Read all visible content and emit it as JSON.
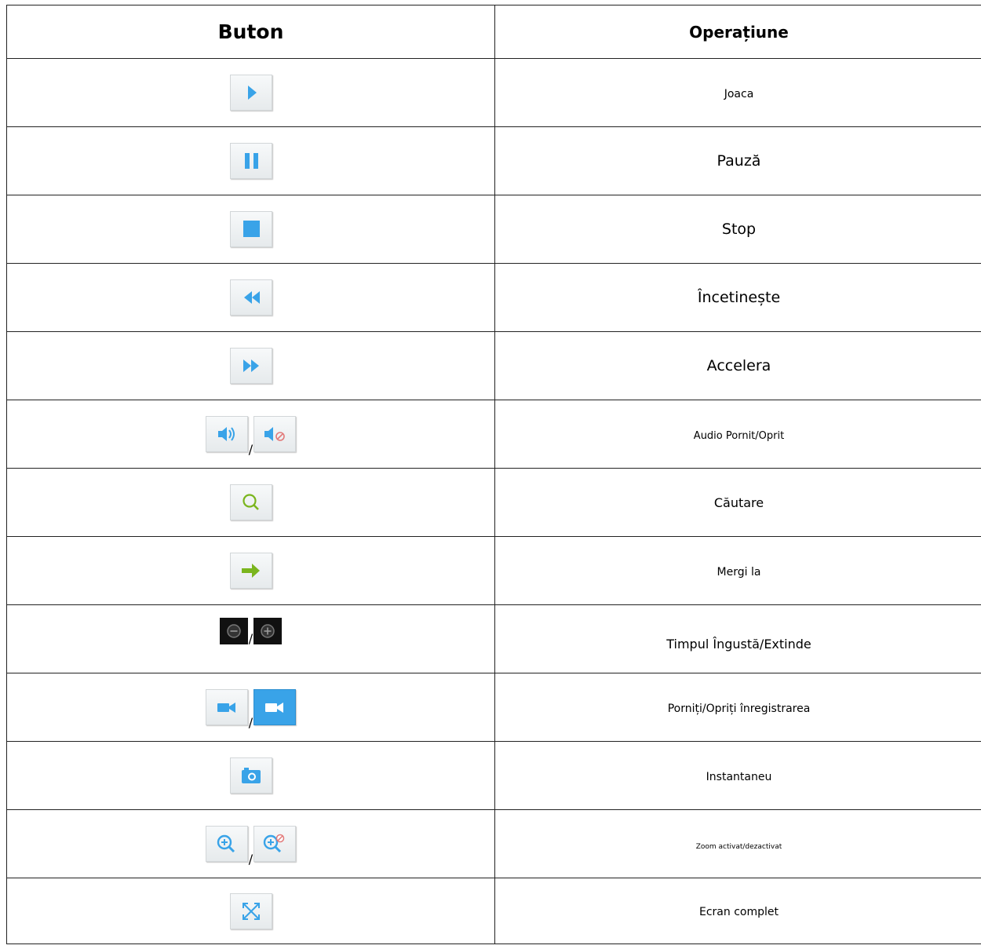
{
  "header": {
    "col_button": "Buton",
    "col_operation": "Operațiune"
  },
  "rows": [
    {
      "icons": [
        "play-icon"
      ],
      "operation": "Joaca"
    },
    {
      "icons": [
        "pause-icon"
      ],
      "operation": "Pauză"
    },
    {
      "icons": [
        "stop-icon"
      ],
      "operation": "Stop"
    },
    {
      "icons": [
        "rewind-icon"
      ],
      "operation": "Încetinește"
    },
    {
      "icons": [
        "fast-forward-icon"
      ],
      "operation": "Accelera"
    },
    {
      "icons": [
        "audio-on-icon",
        "audio-off-icon"
      ],
      "separator": "/",
      "operation": "Audio Pornit/Oprit"
    },
    {
      "icons": [
        "search-icon"
      ],
      "operation": "Căutare"
    },
    {
      "icons": [
        "go-to-arrow-icon"
      ],
      "operation": "Mergi la"
    },
    {
      "icons": [
        "zoom-out-minus-icon",
        "zoom-in-plus-icon"
      ],
      "separator": "/",
      "operation": "Timpul Îngustă/Extinde"
    },
    {
      "icons": [
        "record-off-icon",
        "record-on-icon"
      ],
      "separator": "/",
      "operation": "Porniți/Opriți înregistrarea"
    },
    {
      "icons": [
        "camera-icon"
      ],
      "operation": "Instantaneu"
    },
    {
      "icons": [
        "magnify-zoom-on-icon",
        "magnify-zoom-off-icon"
      ],
      "separator": "/",
      "operation": "Zoom activat/dezactivat"
    },
    {
      "icons": [
        "fullscreen-icon"
      ],
      "operation": "Ecran complet"
    }
  ],
  "colors": {
    "icon_blue": "#39a3e8",
    "icon_green": "#7ab51d",
    "border": "#222222"
  }
}
